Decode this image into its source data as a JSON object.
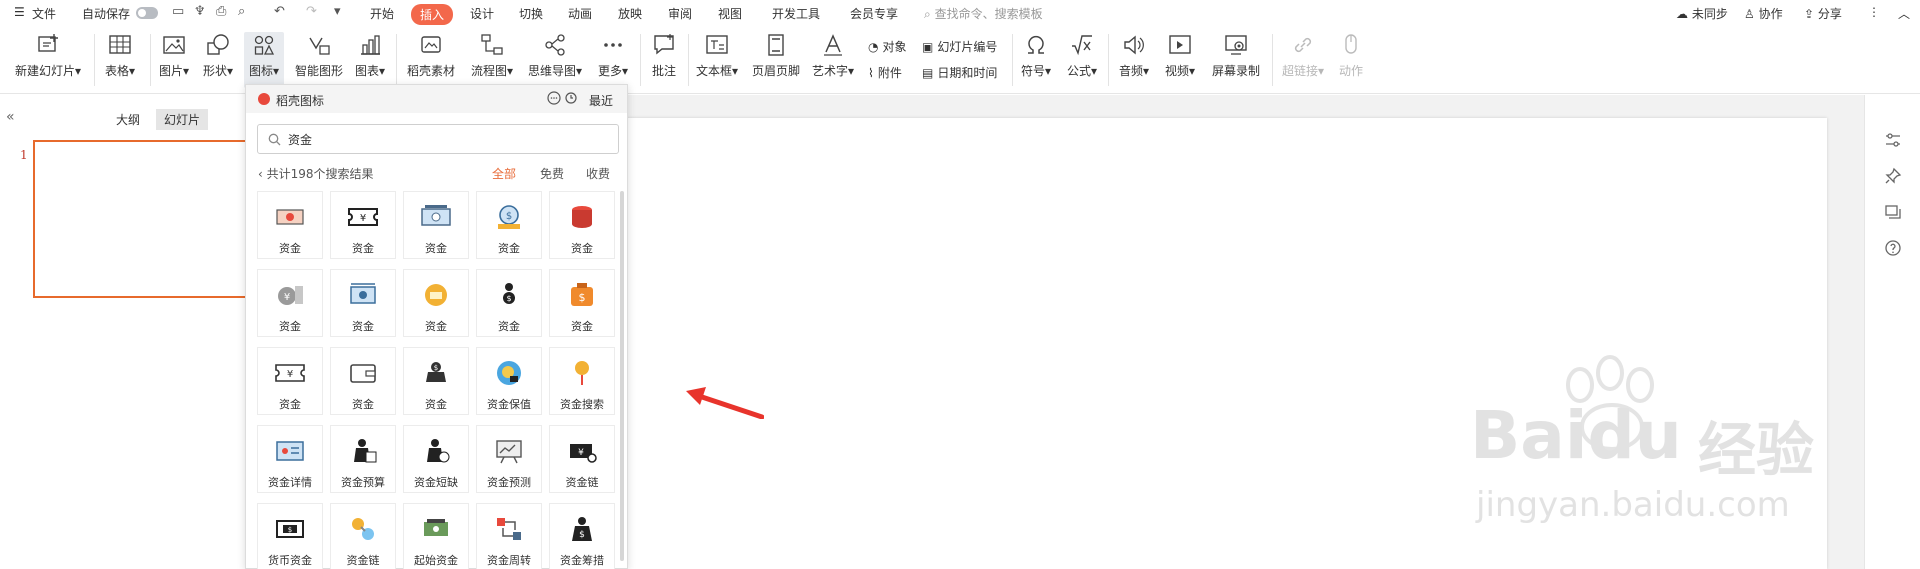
{
  "menubar": {
    "file_label": "文件",
    "autosave_label": "自动保存",
    "tabs": [
      {
        "label": "开始"
      },
      {
        "label": "插入"
      },
      {
        "label": "设计"
      },
      {
        "label": "切换"
      },
      {
        "label": "动画"
      },
      {
        "label": "放映"
      },
      {
        "label": "审阅"
      },
      {
        "label": "视图"
      },
      {
        "label": "开发工具"
      },
      {
        "label": "会员专享"
      }
    ],
    "active_tab": "插入",
    "search_placeholder": "查找命令、搜索模板",
    "sync_label": "未同步",
    "collab_label": "协作",
    "share_label": "分享"
  },
  "ribbon": {
    "new_slide": "新建幻灯片",
    "table": "表格",
    "picture": "图片",
    "shape": "形状",
    "icon": "图标",
    "smart_art": "智能图形",
    "chart": "图表",
    "material": "稻壳素材",
    "flowchart": "流程图",
    "mindmap": "思维导图",
    "more": "更多",
    "comment": "批注",
    "textbox": "文本框",
    "header_footer": "页眉页脚",
    "wordart": "艺术字",
    "object": "对象",
    "attachment": "附件",
    "slide_number": "幻灯片编号",
    "date_time": "日期和时间",
    "symbol": "符号",
    "formula": "公式",
    "audio": "音频",
    "video": "视频",
    "screen_record": "屏幕录制",
    "hyperlink": "超链接",
    "action": "动作"
  },
  "leftpanel": {
    "outline_tab": "大纲",
    "slides_tab": "幻灯片",
    "slide_number": "1"
  },
  "popup": {
    "title": "稻壳图标",
    "recent_label": "最近",
    "search_value": "资金",
    "result_count": "共计198个搜索结果",
    "filters": [
      {
        "label": "全部"
      },
      {
        "label": "免费"
      },
      {
        "label": "收费"
      }
    ],
    "active_filter": "全部",
    "icons": [
      {
        "label": "资金",
        "icon": "money-bill-icon"
      },
      {
        "label": "资金",
        "icon": "yen-ticket-icon"
      },
      {
        "label": "资金",
        "icon": "cash-stack-icon"
      },
      {
        "label": "资金",
        "icon": "money-gear-icon"
      },
      {
        "label": "资金",
        "icon": "coin-stack-icon"
      },
      {
        "label": "资金",
        "icon": "yen-coins-icon"
      },
      {
        "label": "资金",
        "icon": "cash-exchange-icon"
      },
      {
        "label": "资金",
        "icon": "gold-coin-icon"
      },
      {
        "label": "资金",
        "icon": "money-person-icon"
      },
      {
        "label": "资金",
        "icon": "money-bag-orange-icon"
      },
      {
        "label": "资金",
        "icon": "yen-ticket-outline-icon"
      },
      {
        "label": "资金",
        "icon": "wallet-icon"
      },
      {
        "label": "资金",
        "icon": "money-pot-icon"
      },
      {
        "label": "资金保值",
        "icon": "bulb-coin-icon"
      },
      {
        "label": "资金搜索",
        "icon": "coin-search-icon"
      },
      {
        "label": "资金详情",
        "icon": "money-detail-icon"
      },
      {
        "label": "资金预算",
        "icon": "budget-bag-icon"
      },
      {
        "label": "资金短缺",
        "icon": "shortage-bag-icon"
      },
      {
        "label": "资金预测",
        "icon": "forecast-board-icon"
      },
      {
        "label": "资金链",
        "icon": "yen-chain-icon"
      },
      {
        "label": "货币资金",
        "icon": "currency-note-icon"
      },
      {
        "label": "资金链",
        "icon": "coin-chain-icon"
      },
      {
        "label": "起始资金",
        "icon": "starting-fund-icon"
      },
      {
        "label": "资金周转",
        "icon": "turnover-icon"
      },
      {
        "label": "资金筹措",
        "icon": "fund-raise-bag-icon"
      }
    ]
  },
  "watermark": {
    "brand": "Baidu",
    "brand_cn": "经验",
    "url": "jingyan.baidu.com"
  },
  "colors": {
    "accent": "#f3684b",
    "selection_border": "#e76a2c",
    "arrow": "#e8342c"
  }
}
